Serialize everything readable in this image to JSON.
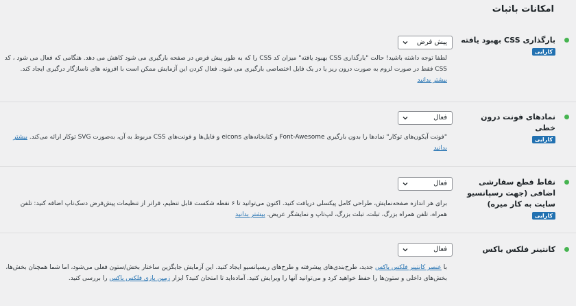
{
  "page": {
    "title": "امکانات باثبات"
  },
  "features": [
    {
      "name": "بارگذاری CSS بهبود یافته",
      "badge": "کارایی",
      "select_value": "پیش فرض",
      "desc_text": "لطفا توجه داشته باشید! حالت \"بارگذاری CSS بهبود یافته\" میزان کد CSS را که به طور پیش فرض در صفحه بارگیری می شود کاهش می دهد. هنگامی که فعال می شود ، کد CSS فقط در صورت لزوم به صورت درون ریز یا در یک فایل اختصاصی بارگیری می شود. فعال کردن این آزمایش ممکن است با افزونه های ناسازگار درگیری ایجاد کند.",
      "learn_more": "بیشتر بدانید"
    },
    {
      "name": "نمادهای فونت درون خطی",
      "badge": "کارایی",
      "select_value": "فعال",
      "desc_text": "\"فونت آیکون‌های توکار\" نمادها را بدون بارگیری Font-Awesome و کتابخانه‌های eicons و فایل‌ها و فونت‌های CSS مربوط به آن، به‌صورت SVG توکار ارائه می‌کند.",
      "learn_more": "بیشتر بدانید"
    },
    {
      "name": "نقاط قطع سفارشی اضافی (جهت رسپانسیو سایت به کار میره)",
      "badge": "کارایی",
      "select_value": "فعال",
      "desc_text": "برای هر اندازه صفحه‌نمایش، طراحی کامل پیکسلی دریافت کنید. اکنون می‌توانید تا ۶ نقطه شکست قابل تنظیم، فراتر از تنظیمات پیش‌فرض دسک‌تاپ اضافه کنید: تلفن همراه، تلفن همراه بزرگ، تبلت، تبلت بزرگ، لپ‌تاپ و نمایشگر عریض.",
      "learn_more": "بیشتر بدانید"
    },
    {
      "name": "کانتینر فلکس باکس",
      "select_value": "فعال",
      "desc_pre": "با",
      "link1": "عنصر کانتینر فلکس باکس",
      "desc_mid": "جدید، طرح‌بندی‌های پیشرفته و طرح‌های ریسپانسیو ایجاد کنید. این آزمایش جایگزین ساختار بخش/ستون فعلی می‌شود، اما شما همچنان بخش‌ها، بخش‌های داخلی و ستون‌ها را حفظ خواهید کرد و می‌توانید آنها را ویرایش کنید. آماده‌اید تا امتحان کنید؟ ابزار",
      "link2": "زمین بازی فلکس باکس",
      "desc_post": "را بررسی کنید."
    }
  ],
  "colors": {
    "accent": "#2271b1",
    "active_dot": "#46b450"
  }
}
